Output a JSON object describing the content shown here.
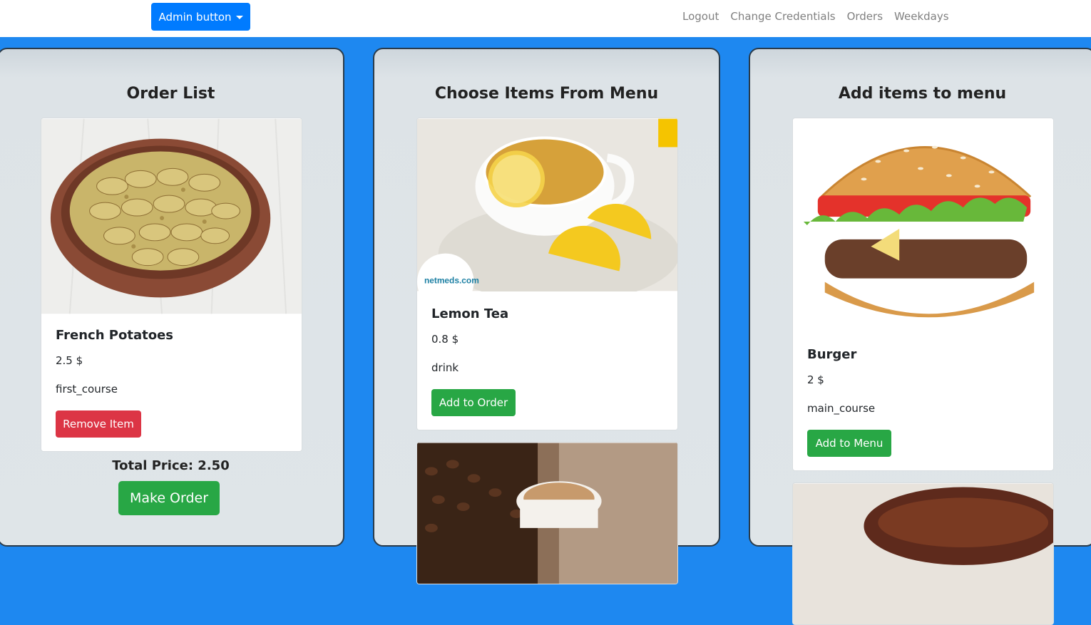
{
  "header": {
    "admin_button": "Admin button",
    "nav": [
      "Logout",
      "Change Credentials",
      "Orders",
      "Weekdays"
    ]
  },
  "order_list": {
    "title": "Order List",
    "item": {
      "name": "French Potatoes",
      "price": "2.5 $",
      "category": "first_course",
      "button": "Remove Item"
    },
    "total": "Total Price: 2.50",
    "make_order": "Make Order"
  },
  "menu": {
    "title": "Choose Items From Menu",
    "item": {
      "name": "Lemon Tea",
      "price": "0.8 $",
      "category": "drink",
      "button": "Add to Order",
      "watermark": "netmeds.com"
    }
  },
  "add_menu": {
    "title": "Add items to menu",
    "item": {
      "name": "Burger",
      "price": "2 $",
      "category": "main_course",
      "button": "Add to Menu"
    }
  },
  "colors": {
    "primary": "#007bff",
    "success": "#28a745",
    "danger": "#dc3545",
    "background": "#1e88f0"
  }
}
